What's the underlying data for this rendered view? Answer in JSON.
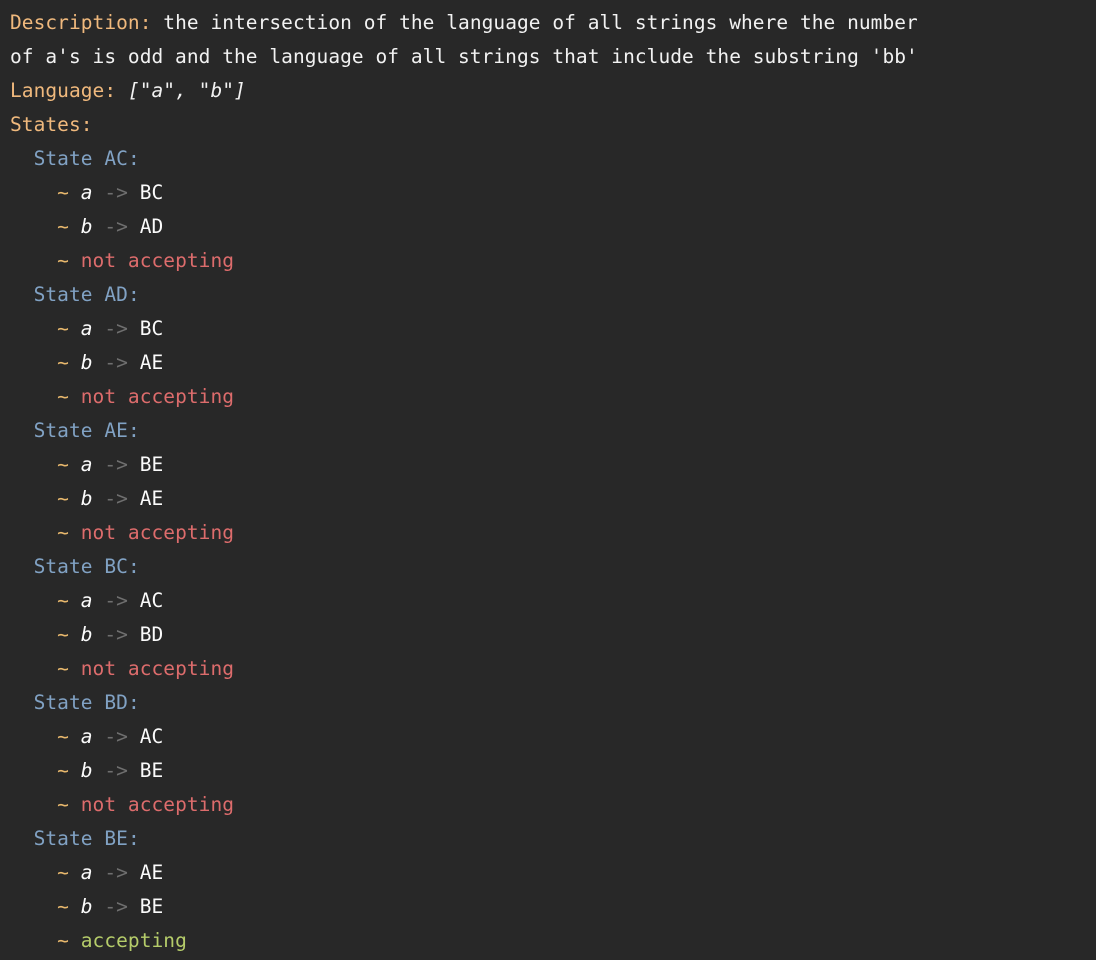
{
  "terminal": {
    "background_color": "#282828",
    "clipped_top_line": "",
    "fields": {
      "description_label": "Description:",
      "description_value": "the intersection of the language of all strings where the number of a's is odd and the language of all strings that include the substring 'bb'",
      "description_line_1": "the intersection of the language of all strings where the number",
      "description_line_2": "of a's is odd and the language of all strings that include the substring 'bb'",
      "language_label": "Language:",
      "language_value": "[\"a\", \"b\"]",
      "language_symbols": [
        "a",
        "b"
      ],
      "states_label": "States:"
    },
    "tokens": {
      "state_keyword": "State",
      "bullet": "~",
      "arrow": "->",
      "colon": ":",
      "accepting_text": "accepting",
      "rejecting_text": "not accepting"
    },
    "colors": {
      "key": "#f0b97d",
      "value": "#f2f2f2",
      "state": "#81a2c4",
      "bullet": "#e8b86d",
      "arrow": "#6f6f6f",
      "accepting": "#b5cc6a",
      "rejecting": "#dd6c6c",
      "background": "#282828"
    },
    "states": [
      {
        "name": "AC",
        "header": "State AC:",
        "transitions": [
          {
            "symbol": "a",
            "target": "BC"
          },
          {
            "symbol": "b",
            "target": "AD"
          }
        ],
        "accepting": false,
        "accepting_text": "not accepting"
      },
      {
        "name": "AD",
        "header": "State AD:",
        "transitions": [
          {
            "symbol": "a",
            "target": "BC"
          },
          {
            "symbol": "b",
            "target": "AE"
          }
        ],
        "accepting": false,
        "accepting_text": "not accepting"
      },
      {
        "name": "AE",
        "header": "State AE:",
        "transitions": [
          {
            "symbol": "a",
            "target": "BE"
          },
          {
            "symbol": "b",
            "target": "AE"
          }
        ],
        "accepting": false,
        "accepting_text": "not accepting"
      },
      {
        "name": "BC",
        "header": "State BC:",
        "transitions": [
          {
            "symbol": "a",
            "target": "AC"
          },
          {
            "symbol": "b",
            "target": "BD"
          }
        ],
        "accepting": false,
        "accepting_text": "not accepting"
      },
      {
        "name": "BD",
        "header": "State BD:",
        "transitions": [
          {
            "symbol": "a",
            "target": "AC"
          },
          {
            "symbol": "b",
            "target": "BE"
          }
        ],
        "accepting": false,
        "accepting_text": "not accepting"
      },
      {
        "name": "BE",
        "header": "State BE:",
        "transitions": [
          {
            "symbol": "a",
            "target": "AE"
          },
          {
            "symbol": "b",
            "target": "BE"
          }
        ],
        "accepting": true,
        "accepting_text": "accepting"
      }
    ]
  }
}
